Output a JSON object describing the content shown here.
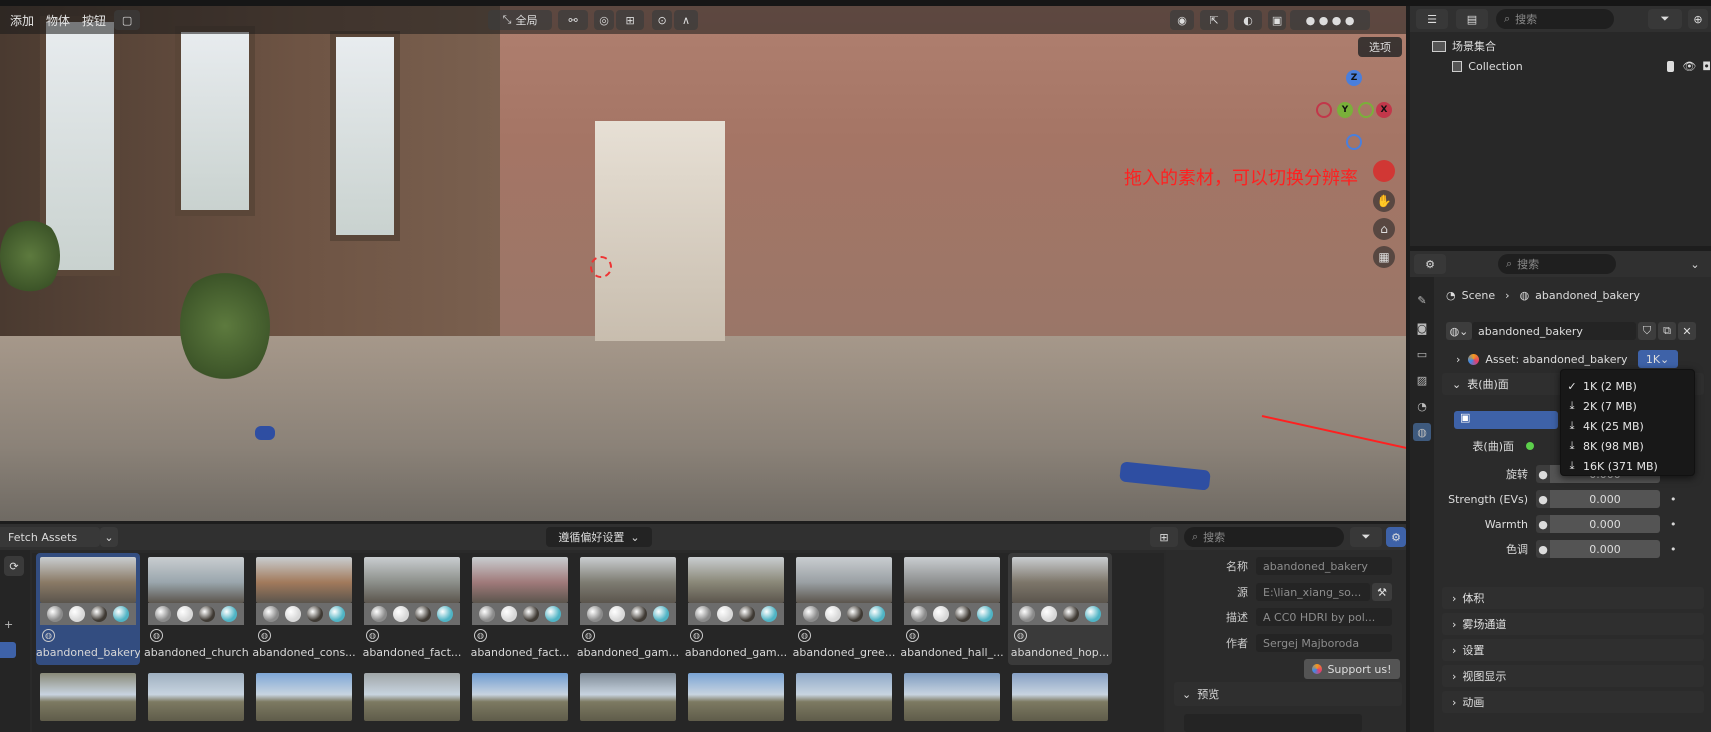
{
  "viewport": {
    "menu": [
      "添加",
      "物体",
      "按钮"
    ],
    "transform_orientation": "全局",
    "options_label": "选项",
    "gizmo": {
      "z": "Z",
      "y": "Y",
      "x": "X"
    },
    "annotation": "拖入的素材，可以切换分辨率"
  },
  "outliner": {
    "search_placeholder": "搜索",
    "scene_collection": "场景集合",
    "collection": "Collection"
  },
  "properties": {
    "search_placeholder": "搜索",
    "breadcrumb": [
      "Scene",
      "abandoned_bakery"
    ],
    "world_name": "abandoned_bakery",
    "asset_label": "Asset: abandoned_bakery",
    "resolution_selected": "1K",
    "surface_section": "表(曲)面",
    "surface_label": "表(曲)面",
    "rotation_label": "旋转",
    "rotation_value": "0.000",
    "strength_label": "Strength (EVs)",
    "strength_value": "0.000",
    "warmth_label": "Warmth",
    "warmth_value": "0.000",
    "tint_label": "色调",
    "tint_value": "0.000",
    "panels": [
      "体积",
      "雾场通道",
      "设置",
      "视图显示",
      "动画"
    ],
    "resolution_options": [
      {
        "label": "1K  (2 MB)",
        "selected": true
      },
      {
        "label": "2K  (7 MB)",
        "selected": false
      },
      {
        "label": "4K  (25 MB)",
        "selected": false
      },
      {
        "label": "8K  (98 MB)",
        "selected": false
      },
      {
        "label": "16K  (371 MB)",
        "selected": false
      }
    ]
  },
  "asset_browser": {
    "library": "Fetch Assets",
    "import_method": "遵循偏好设置",
    "search_placeholder": "搜索",
    "items": [
      {
        "label": "abandoned_bakery",
        "selected": true,
        "pano_color": "#8a7a66"
      },
      {
        "label": "abandoned_church",
        "selected": false,
        "pano_color": "#9aa6ad"
      },
      {
        "label": "abandoned_cons...",
        "selected": false,
        "pano_color": "#a27a5c"
      },
      {
        "label": "abandoned_fact...",
        "selected": false,
        "pano_color": "#8c8f8a"
      },
      {
        "label": "abandoned_fact...",
        "selected": false,
        "pano_color": "#a07a7a"
      },
      {
        "label": "abandoned_gam...",
        "selected": false,
        "pano_color": "#7e7c72"
      },
      {
        "label": "abandoned_gam...",
        "selected": false,
        "pano_color": "#8a8878"
      },
      {
        "label": "abandoned_gree...",
        "selected": false,
        "pano_color": "#9aa0a4"
      },
      {
        "label": "abandoned_hall_...",
        "selected": false,
        "pano_color": "#8e9090"
      },
      {
        "label": "abandoned_hop...",
        "selected": false,
        "pano_color": "#7d766a"
      }
    ],
    "row2_colors": [
      "#8a8a78",
      "#9fb0c0",
      "#7ea7d6",
      "#a0a6a8",
      "#6d9bd0",
      "#7e8a96",
      "#7aa4d4",
      "#8fa9c8",
      "#7e9cc0",
      "#86a0c4"
    ],
    "metadata": {
      "name_label": "名称",
      "name_value": "abandoned_bakery",
      "source_label": "源",
      "source_value": "E:\\lian_xiang_so...",
      "desc_label": "描述",
      "desc_value": "A CC0 HDRI by pol...",
      "author_label": "作者",
      "author_value": "Sergej Majboroda",
      "support_label": "Support us!",
      "preview_label": "预览"
    }
  }
}
